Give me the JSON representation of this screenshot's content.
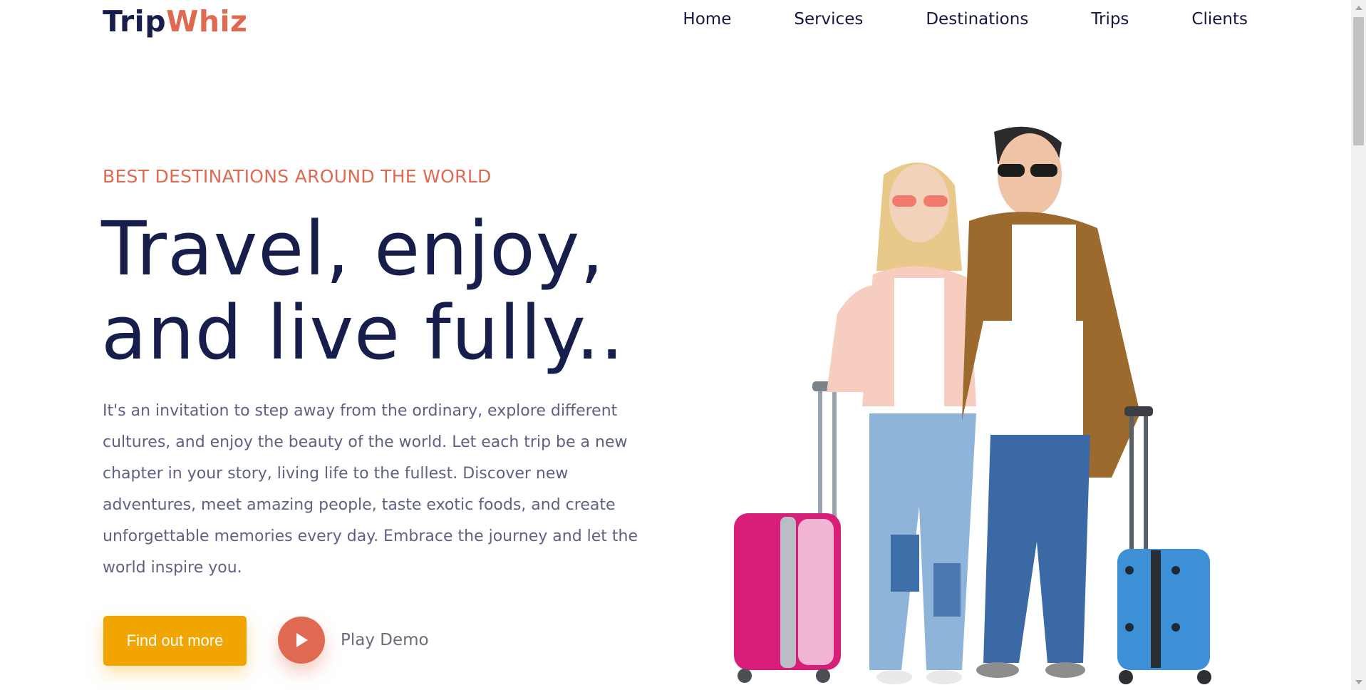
{
  "brand": {
    "part1": "Trip",
    "part2": "Whiz"
  },
  "nav": [
    "Home",
    "Services",
    "Destinations",
    "Trips",
    "Clients"
  ],
  "hero": {
    "eyebrow": "BEST DESTINATIONS AROUND THE WORLD",
    "headline_line1": "Travel, enjoy,",
    "headline_line2": "and live fully..",
    "description": "It's an invitation to step away from the ordinary, explore different cultures, and enjoy the beauty of the world. Let each trip be a new chapter in your story, living life to the fullest. Discover new adventures, meet amazing people, taste exotic foods, and create unforgettable memories every day. Embrace the journey and let the world inspire you.",
    "cta_label": "Find out more",
    "play_label": "Play Demo"
  },
  "colors": {
    "accent": "#DF6951",
    "cta": "#F1A501",
    "heading": "#181E4B",
    "body_text": "#5E6282"
  },
  "icons": {
    "play": "play-icon"
  }
}
